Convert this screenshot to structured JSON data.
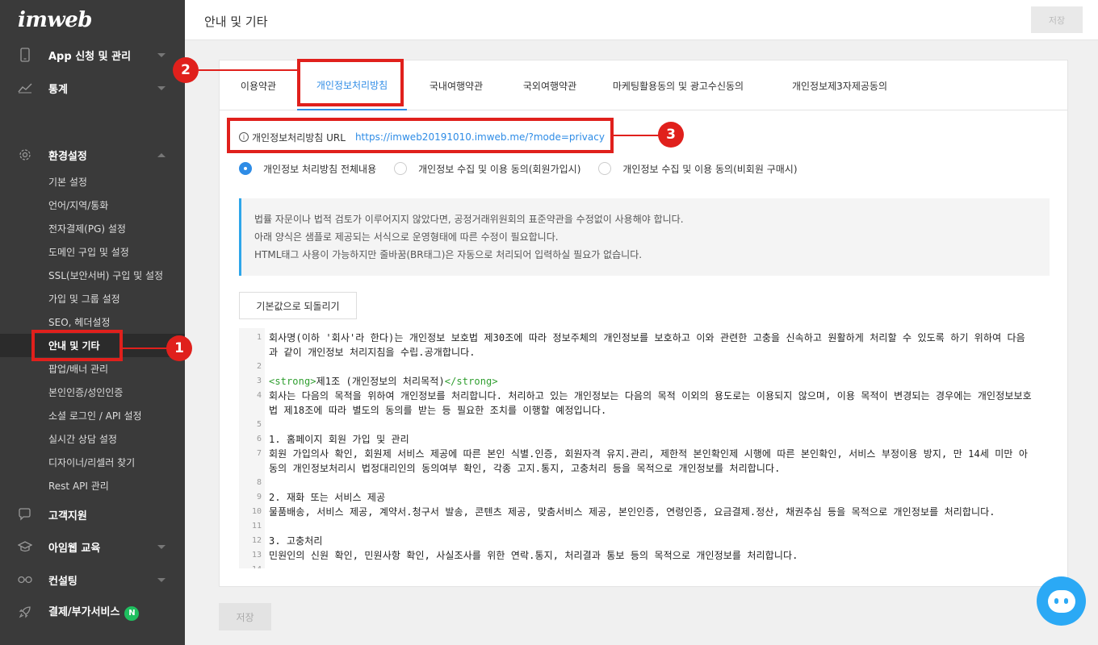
{
  "sidebar": {
    "logo": "imweb",
    "top_items": [
      {
        "label": "App 신청 및 관리",
        "icon": "mobile-icon"
      },
      {
        "label": "통계",
        "icon": "chart-icon"
      }
    ],
    "settings": {
      "label": "환경설정",
      "icon": "gear-icon"
    },
    "sub_items": [
      "기본 설정",
      "언어/지역/통화",
      "전자결제(PG) 설정",
      "도메인 구입 및 설정",
      "SSL(보안서버) 구입 및 설정",
      "가입 및 그룹 설정",
      "SEO, 헤더설정",
      "안내 및 기타",
      "팝업/배너 관리",
      "본인인증/성인인증",
      "소셜 로그인 / API 설정",
      "실시간 상담 설정",
      "디자이너/리셀러 찾기",
      "Rest API 관리"
    ],
    "bottom_items": [
      {
        "label": "고객지원",
        "icon": "chat-bubble-icon"
      },
      {
        "label": "아임웹 교육",
        "icon": "graduation-cap-icon"
      },
      {
        "label": "컨설팅",
        "icon": "glasses-icon"
      },
      {
        "label": "결제/부가서비스",
        "icon": "rocket-icon",
        "badge": "N"
      }
    ]
  },
  "header": {
    "title": "안내 및 기타",
    "save_label": "저장"
  },
  "tabs": [
    "이용약관",
    "개인정보처리방침",
    "국내여행약관",
    "국외여행약관",
    "마케팅활용동의 및 광고수신동의",
    "개인정보제3자제공동의"
  ],
  "active_tab": "개인정보처리방침",
  "url_row": {
    "icon": "i",
    "label": "개인정보처리방침 URL",
    "url": "https://imweb20191010.imweb.me/?mode=privacy"
  },
  "radios": [
    {
      "label": "개인정보 처리방침 전체내용",
      "checked": true
    },
    {
      "label": "개인정보 수집 및 이용 동의(회원가입시)",
      "checked": false
    },
    {
      "label": "개인정보 수집 및 이용 동의(비회원 구매시)",
      "checked": false
    }
  ],
  "notice": [
    "법률 자문이나 법적 검토가 이루어지지 않았다면, 공정거래위원회의 표준약관을 수정없이 사용해야 합니다.",
    "아래 양식은 샘플로 제공되는 서식으로 운영형태에 따른 수정이 필요합니다.",
    "HTML태그 사용이 가능하지만 줄바꿈(BR태그)은 자동으로 처리되어 입력하실 필요가 없습니다."
  ],
  "reset_label": "기본값으로 되돌리기",
  "editor_lines": [
    {
      "n": "1",
      "text": "회사명(이하 '회사'라 한다)는 개인정보 보호법 제30조에 따라 정보주체의 개인정보를 보호하고 이와 관련한 고충을 신속하고 원활하게 처리할 수 있도록 하기 위하여 다음"
    },
    {
      "n": "",
      "text": "과 같이 개인정보 처리지침을 수립.공개합니다."
    },
    {
      "n": "2",
      "text": ""
    },
    {
      "n": "3",
      "tag_open": "<strong>",
      "text": "제1조 (개인정보의 처리목적)",
      "tag_close": "</strong>"
    },
    {
      "n": "4",
      "text": "회사는 다음의 목적을 위하여 개인정보를 처리합니다. 처리하고 있는 개인정보는 다음의 목적 이외의 용도로는 이용되지 않으며, 이용 목적이 변경되는 경우에는 개인정보보호"
    },
    {
      "n": "",
      "text": "법 제18조에 따라 별도의 동의를 받는 등 필요한 조치를 이행할 예정입니다."
    },
    {
      "n": "5",
      "text": ""
    },
    {
      "n": "6",
      "text": "1. 홈페이지 회원 가입 및 관리"
    },
    {
      "n": "7",
      "text": "회원 가입의사 확인, 회원제 서비스 제공에 따른 본인 식별.인증, 회원자격 유지.관리, 제한적 본인확인제 시행에 따른 본인확인, 서비스 부정이용 방지, 만 14세 미만 아"
    },
    {
      "n": "",
      "text": "동의 개인정보처리시 법정대리인의 동의여부 확인, 각종 고지.통지, 고충처리 등을 목적으로 개인정보를 처리합니다."
    },
    {
      "n": "8",
      "text": ""
    },
    {
      "n": "9",
      "text": "2. 재화 또는 서비스 제공"
    },
    {
      "n": "10",
      "text": "물품배송, 서비스 제공, 계약서.청구서 발송, 콘텐츠 제공, 맞춤서비스 제공, 본인인증, 연령인증, 요금결제.정산, 채권추심 등을 목적으로 개인정보를 처리합니다."
    },
    {
      "n": "11",
      "text": ""
    },
    {
      "n": "12",
      "text": "3. 고충처리"
    },
    {
      "n": "13",
      "text": "민원인의 신원 확인, 민원사항 확인, 사실조사를 위한 연락.통지, 처리결과 통보 등의 목적으로 개인정보를 처리합니다."
    },
    {
      "n": "14",
      "text": ""
    }
  ],
  "bottom_save_label": "저장",
  "callouts": [
    "1",
    "2",
    "3"
  ],
  "colors": {
    "accent": "#2e8ce6",
    "callout_red": "#e0201c",
    "sidebar_bg": "#3a3a3a",
    "chat": "#2ba9f5"
  }
}
